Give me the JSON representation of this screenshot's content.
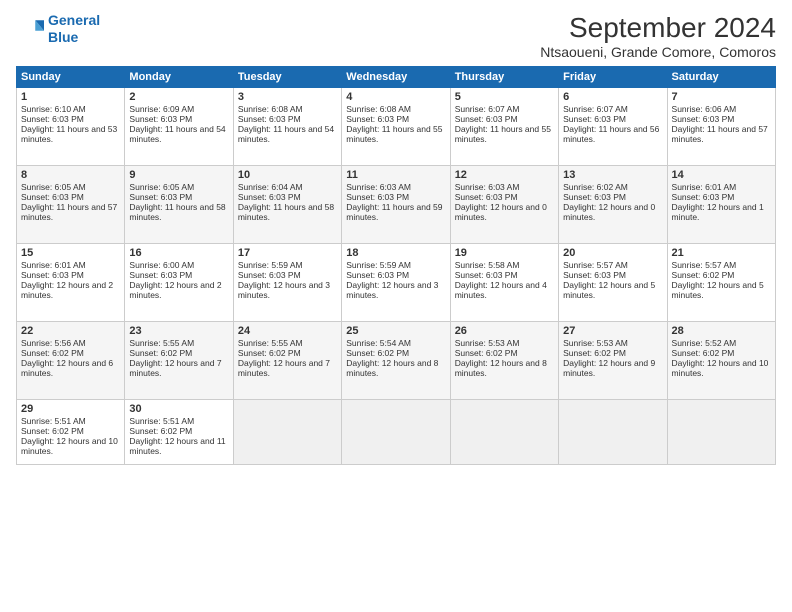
{
  "header": {
    "logo_line1": "General",
    "logo_line2": "Blue",
    "month": "September 2024",
    "location": "Ntsaoueni, Grande Comore, Comoros"
  },
  "weekdays": [
    "Sunday",
    "Monday",
    "Tuesday",
    "Wednesday",
    "Thursday",
    "Friday",
    "Saturday"
  ],
  "weeks": [
    [
      {
        "day": "1",
        "sunrise": "6:10 AM",
        "sunset": "6:03 PM",
        "daylight": "11 hours and 53 minutes."
      },
      {
        "day": "2",
        "sunrise": "6:09 AM",
        "sunset": "6:03 PM",
        "daylight": "11 hours and 54 minutes."
      },
      {
        "day": "3",
        "sunrise": "6:08 AM",
        "sunset": "6:03 PM",
        "daylight": "11 hours and 54 minutes."
      },
      {
        "day": "4",
        "sunrise": "6:08 AM",
        "sunset": "6:03 PM",
        "daylight": "11 hours and 55 minutes."
      },
      {
        "day": "5",
        "sunrise": "6:07 AM",
        "sunset": "6:03 PM",
        "daylight": "11 hours and 55 minutes."
      },
      {
        "day": "6",
        "sunrise": "6:07 AM",
        "sunset": "6:03 PM",
        "daylight": "11 hours and 56 minutes."
      },
      {
        "day": "7",
        "sunrise": "6:06 AM",
        "sunset": "6:03 PM",
        "daylight": "11 hours and 57 minutes."
      }
    ],
    [
      {
        "day": "8",
        "sunrise": "6:05 AM",
        "sunset": "6:03 PM",
        "daylight": "11 hours and 57 minutes."
      },
      {
        "day": "9",
        "sunrise": "6:05 AM",
        "sunset": "6:03 PM",
        "daylight": "11 hours and 58 minutes."
      },
      {
        "day": "10",
        "sunrise": "6:04 AM",
        "sunset": "6:03 PM",
        "daylight": "11 hours and 58 minutes."
      },
      {
        "day": "11",
        "sunrise": "6:03 AM",
        "sunset": "6:03 PM",
        "daylight": "11 hours and 59 minutes."
      },
      {
        "day": "12",
        "sunrise": "6:03 AM",
        "sunset": "6:03 PM",
        "daylight": "12 hours and 0 minutes."
      },
      {
        "day": "13",
        "sunrise": "6:02 AM",
        "sunset": "6:03 PM",
        "daylight": "12 hours and 0 minutes."
      },
      {
        "day": "14",
        "sunrise": "6:01 AM",
        "sunset": "6:03 PM",
        "daylight": "12 hours and 1 minute."
      }
    ],
    [
      {
        "day": "15",
        "sunrise": "6:01 AM",
        "sunset": "6:03 PM",
        "daylight": "12 hours and 2 minutes."
      },
      {
        "day": "16",
        "sunrise": "6:00 AM",
        "sunset": "6:03 PM",
        "daylight": "12 hours and 2 minutes."
      },
      {
        "day": "17",
        "sunrise": "5:59 AM",
        "sunset": "6:03 PM",
        "daylight": "12 hours and 3 minutes."
      },
      {
        "day": "18",
        "sunrise": "5:59 AM",
        "sunset": "6:03 PM",
        "daylight": "12 hours and 3 minutes."
      },
      {
        "day": "19",
        "sunrise": "5:58 AM",
        "sunset": "6:03 PM",
        "daylight": "12 hours and 4 minutes."
      },
      {
        "day": "20",
        "sunrise": "5:57 AM",
        "sunset": "6:03 PM",
        "daylight": "12 hours and 5 minutes."
      },
      {
        "day": "21",
        "sunrise": "5:57 AM",
        "sunset": "6:02 PM",
        "daylight": "12 hours and 5 minutes."
      }
    ],
    [
      {
        "day": "22",
        "sunrise": "5:56 AM",
        "sunset": "6:02 PM",
        "daylight": "12 hours and 6 minutes."
      },
      {
        "day": "23",
        "sunrise": "5:55 AM",
        "sunset": "6:02 PM",
        "daylight": "12 hours and 7 minutes."
      },
      {
        "day": "24",
        "sunrise": "5:55 AM",
        "sunset": "6:02 PM",
        "daylight": "12 hours and 7 minutes."
      },
      {
        "day": "25",
        "sunrise": "5:54 AM",
        "sunset": "6:02 PM",
        "daylight": "12 hours and 8 minutes."
      },
      {
        "day": "26",
        "sunrise": "5:53 AM",
        "sunset": "6:02 PM",
        "daylight": "12 hours and 8 minutes."
      },
      {
        "day": "27",
        "sunrise": "5:53 AM",
        "sunset": "6:02 PM",
        "daylight": "12 hours and 9 minutes."
      },
      {
        "day": "28",
        "sunrise": "5:52 AM",
        "sunset": "6:02 PM",
        "daylight": "12 hours and 10 minutes."
      }
    ],
    [
      {
        "day": "29",
        "sunrise": "5:51 AM",
        "sunset": "6:02 PM",
        "daylight": "12 hours and 10 minutes."
      },
      {
        "day": "30",
        "sunrise": "5:51 AM",
        "sunset": "6:02 PM",
        "daylight": "12 hours and 11 minutes."
      },
      null,
      null,
      null,
      null,
      null
    ]
  ]
}
